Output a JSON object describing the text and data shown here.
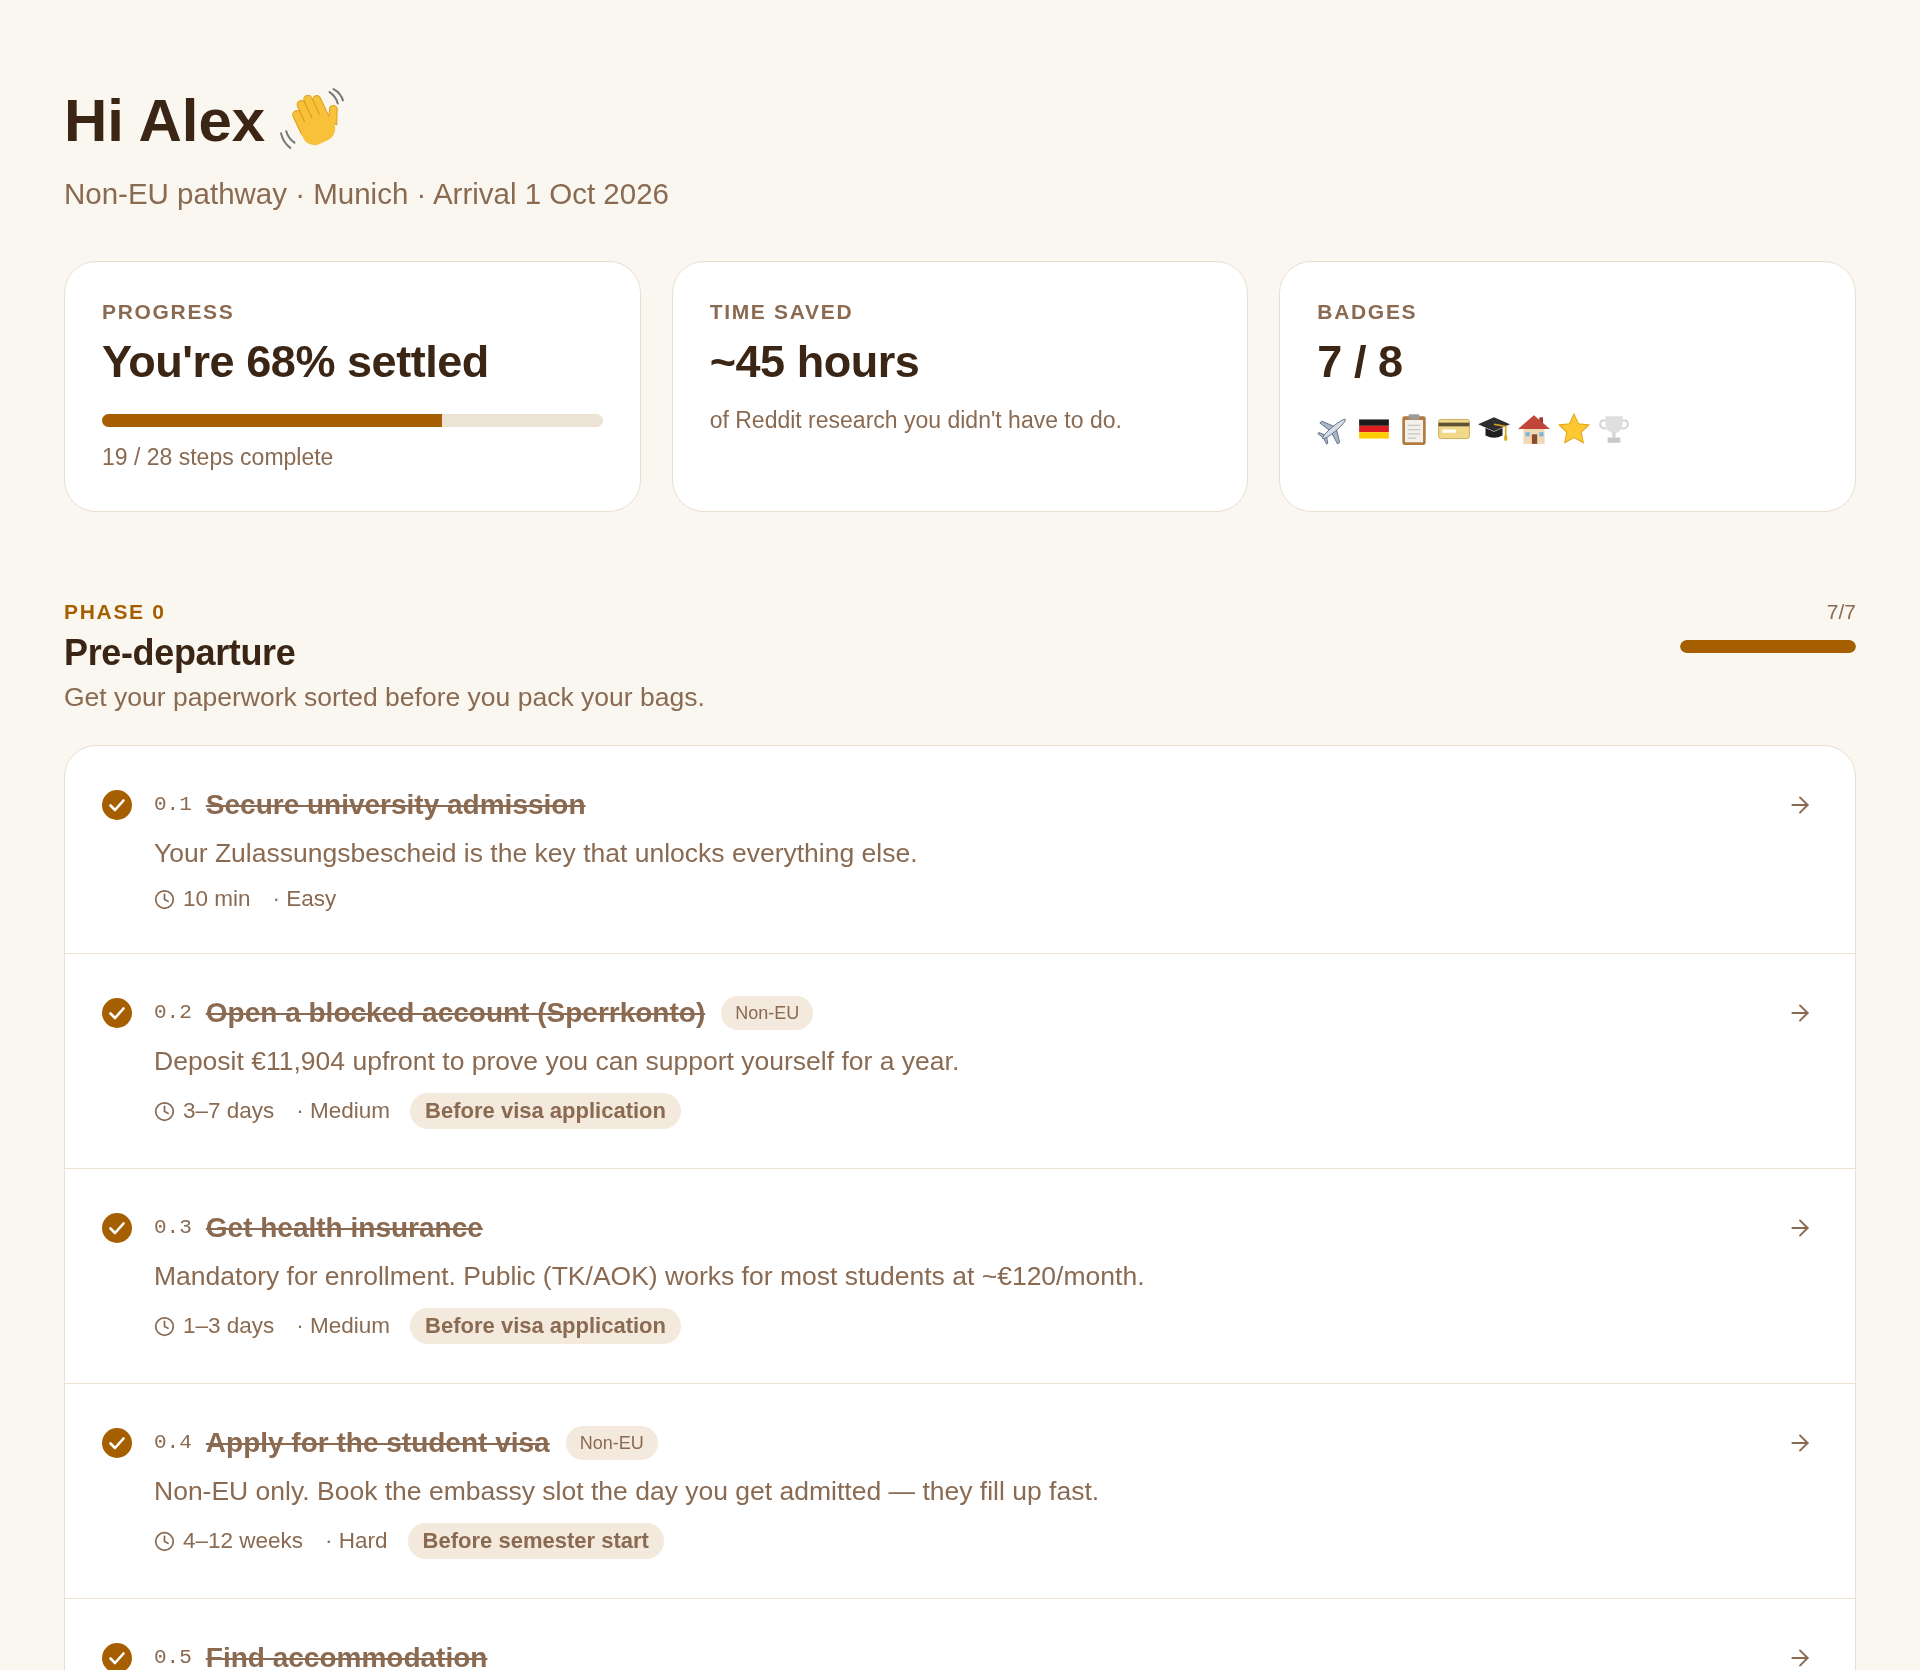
{
  "greeting": {
    "title": "Hi Alex",
    "subtitle": "Non-EU pathway · Munich · Arrival 1 Oct 2026"
  },
  "stats": [
    {
      "kind": "progress",
      "label": "PROGRESS",
      "value": "You're 68% settled",
      "level": 0.68,
      "caption": "19 / 28 steps complete"
    },
    {
      "kind": "metric",
      "label": "TIME SAVED",
      "value": "~45 hours",
      "caption": "of Reddit research you didn't have to do."
    },
    {
      "kind": "badges",
      "label": "BADGES",
      "value": "7 / 8",
      "badges": [
        {
          "kind": "airplane",
          "earned": true
        },
        {
          "kind": "flag",
          "earned": true
        },
        {
          "kind": "clipboard",
          "earned": true
        },
        {
          "kind": "credit_card",
          "earned": true
        },
        {
          "kind": "graduation_cap",
          "earned": true
        },
        {
          "kind": "house",
          "earned": true
        },
        {
          "kind": "star",
          "earned": true
        },
        {
          "kind": "trophy",
          "earned": false
        }
      ]
    }
  ],
  "phase": {
    "label": "PHASE 0",
    "title": "Pre-departure",
    "description": "Get your paperwork sorted before you pack your bags.",
    "count": "7/7",
    "level": 1,
    "steps": [
      {
        "number": "0.1",
        "title": "Secure university admission",
        "done": true,
        "description": "Your Zulassungsbescheid is the key that unlocks everything else.",
        "duration": "10 min",
        "difficulty": "· Easy"
      },
      {
        "number": "0.2",
        "title": "Open a blocked account (Sperrkonto)",
        "done": true,
        "tag": "Non-EU",
        "description": "Deposit €11,904 upfront to prove you can support yourself for a year.",
        "duration": "3–7 days",
        "difficulty": "· Medium",
        "deadline": "Before visa application"
      },
      {
        "number": "0.3",
        "title": "Get health insurance",
        "done": true,
        "description": "Mandatory for enrollment. Public (TK/AOK) works for most students at ~€120/month.",
        "duration": "1–3 days",
        "difficulty": "· Medium",
        "deadline": "Before visa application"
      },
      {
        "number": "0.4",
        "title": "Apply for the student visa",
        "done": true,
        "tag": "Non-EU",
        "description": "Non-EU only. Book the embassy slot the day you get admitted — they fill up fast.",
        "duration": "4–12 weeks",
        "difficulty": "· Hard",
        "deadline": "Before semester start"
      },
      {
        "number": "0.5",
        "title": "Find accommodation",
        "done": true
      }
    ]
  }
}
